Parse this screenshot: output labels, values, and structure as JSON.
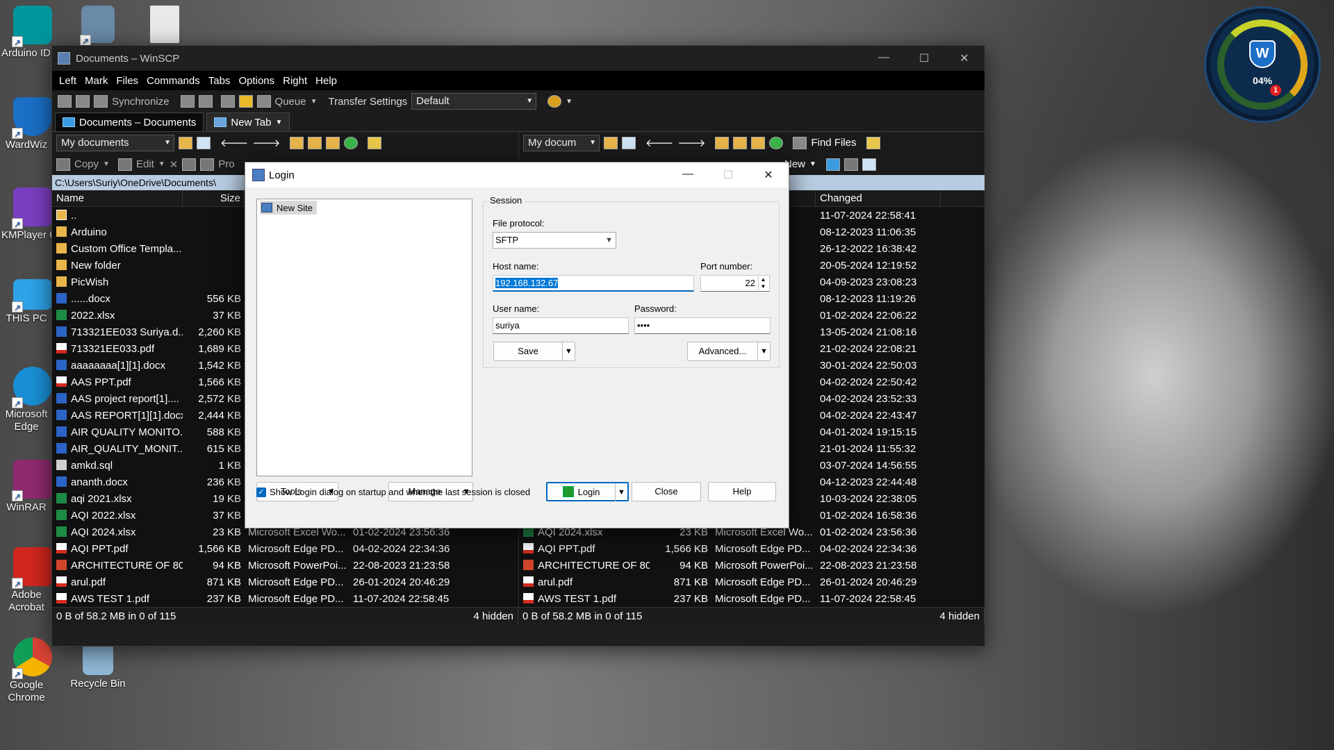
{
  "desktop": {
    "icons": [
      {
        "label": "Arduino IDE"
      },
      {
        "label": "WardWiz"
      },
      {
        "label": "KMPlayer 64"
      },
      {
        "label": "THIS PC"
      },
      {
        "label": "Microsoft Edge"
      },
      {
        "label": "WinRAR"
      },
      {
        "label": "Adobe Acrobat"
      },
      {
        "label": "Google Chrome"
      },
      {
        "label": "Recycle Bin"
      }
    ],
    "gadget": {
      "percent": "04%",
      "badge": "1"
    }
  },
  "window": {
    "title": "Documents – WinSCP",
    "menu": [
      "Left",
      "Mark",
      "Files",
      "Commands",
      "Tabs",
      "Options",
      "Right",
      "Help"
    ],
    "toolbar": {
      "synchronize": "Synchronize",
      "queue": "Queue",
      "transfer_settings": "Transfer Settings",
      "transfer_value": "Default"
    },
    "tabs": [
      {
        "label": "Documents – Documents"
      },
      {
        "label": "New Tab"
      }
    ],
    "left_pane": {
      "location": "My documents",
      "copy": "Copy",
      "edit": "Edit",
      "properties": "Pro",
      "path": "C:\\Users\\Suriy\\OneDrive\\Documents\\",
      "col_name": "Name",
      "col_size": "Size",
      "files": [
        {
          "name": "..",
          "size": "",
          "type": "",
          "changed": "",
          "icon": "up"
        },
        {
          "name": "Arduino",
          "size": "",
          "type": "",
          "changed": "",
          "icon": "folder"
        },
        {
          "name": "Custom Office Templa...",
          "size": "",
          "type": "",
          "changed": "",
          "icon": "folder"
        },
        {
          "name": "New folder",
          "size": "",
          "type": "",
          "changed": "",
          "icon": "folder"
        },
        {
          "name": "PicWish",
          "size": "",
          "type": "",
          "changed": "",
          "icon": "folder"
        },
        {
          "name": "......docx",
          "size": "556 KB",
          "type": "",
          "changed": "",
          "icon": "word"
        },
        {
          "name": "2022.xlsx",
          "size": "37 KB",
          "type": "",
          "changed": "",
          "icon": "excel"
        },
        {
          "name": "713321EE033 Suriya.d...",
          "size": "2,260 KB",
          "type": "",
          "changed": "",
          "icon": "word"
        },
        {
          "name": "713321EE033.pdf",
          "size": "1,689 KB",
          "type": "",
          "changed": "",
          "icon": "pdf"
        },
        {
          "name": "aaaaaaaa[1][1].docx",
          "size": "1,542 KB",
          "type": "",
          "changed": "",
          "icon": "word"
        },
        {
          "name": "AAS PPT.pdf",
          "size": "1,566 KB",
          "type": "",
          "changed": "",
          "icon": "pdf"
        },
        {
          "name": "AAS project report[1]....",
          "size": "2,572 KB",
          "type": "",
          "changed": "",
          "icon": "word"
        },
        {
          "name": "AAS REPORT[1][1].docx",
          "size": "2,444 KB",
          "type": "",
          "changed": "",
          "icon": "word"
        },
        {
          "name": "AIR QUALITY MONITO...",
          "size": "588 KB",
          "type": "",
          "changed": "",
          "icon": "word"
        },
        {
          "name": "AIR_QUALITY_MONIT...",
          "size": "615 KB",
          "type": "",
          "changed": "",
          "icon": "word"
        },
        {
          "name": "amkd.sql",
          "size": "1 KB",
          "type": "",
          "changed": "",
          "icon": "sql"
        },
        {
          "name": "ananth.docx",
          "size": "236 KB",
          "type": "",
          "changed": "",
          "icon": "word"
        },
        {
          "name": "aqi 2021.xlsx",
          "size": "19 KB",
          "type": "",
          "changed": "",
          "icon": "excel"
        },
        {
          "name": "AQI 2022.xlsx",
          "size": "37 KB",
          "type": "",
          "changed": "",
          "icon": "excel"
        },
        {
          "name": "AQI 2024.xlsx",
          "size": "23 KB",
          "type": "Microsoft Excel Wo...",
          "changed": "01-02-2024 23:56:36",
          "icon": "excel"
        },
        {
          "name": "AQI PPT.pdf",
          "size": "1,566 KB",
          "type": "Microsoft Edge PD...",
          "changed": "04-02-2024 22:34:36",
          "icon": "pdf"
        },
        {
          "name": "ARCHITECTURE  OF 80...",
          "size": "94 KB",
          "type": "Microsoft PowerPoi...",
          "changed": "22-08-2023 21:23:58",
          "icon": "ppt"
        },
        {
          "name": "arul.pdf",
          "size": "871 KB",
          "type": "Microsoft Edge PD...",
          "changed": "26-01-2024 20:46:29",
          "icon": "pdf"
        },
        {
          "name": "AWS TEST 1.pdf",
          "size": "237 KB",
          "type": "Microsoft Edge PD...",
          "changed": "11-07-2024 22:58:45",
          "icon": "pdf"
        }
      ],
      "status": "0 B of 58.2 MB in 0 of 115",
      "hidden": "4 hidden"
    },
    "right_pane": {
      "location": "My docum",
      "find_files": "Find Files",
      "new": "New",
      "col_changed": "Changed",
      "files": [
        {
          "name": "",
          "size": "",
          "type": "",
          "changed": "11-07-2024 22:58:41",
          "icon": ""
        },
        {
          "name": "",
          "size": "",
          "type": "",
          "changed": "08-12-2023 11:06:35",
          "icon": ""
        },
        {
          "name": "",
          "size": "",
          "type": "",
          "changed": "26-12-2022 16:38:42",
          "icon": ""
        },
        {
          "name": "",
          "size": "",
          "type": "",
          "changed": "20-05-2024 12:19:52",
          "icon": ""
        },
        {
          "name": "",
          "size": "",
          "type": "",
          "changed": "04-09-2023 23:08:23",
          "icon": ""
        },
        {
          "name": "",
          "size": "",
          "type": "Do...",
          "changed": "08-12-2023 11:19:26",
          "icon": ""
        },
        {
          "name": "",
          "size": "",
          "type": "Wo...",
          "changed": "01-02-2024 22:06:22",
          "icon": ""
        },
        {
          "name": "",
          "size": "",
          "type": "Do...",
          "changed": "13-05-2024 21:08:16",
          "icon": ""
        },
        {
          "name": "",
          "size": "",
          "type": "PD...",
          "changed": "21-02-2024 22:08:21",
          "icon": ""
        },
        {
          "name": "",
          "size": "",
          "type": "Do...",
          "changed": "30-01-2024 22:50:03",
          "icon": ""
        },
        {
          "name": "",
          "size": "",
          "type": "PD...",
          "changed": "04-02-2024 22:50:42",
          "icon": ""
        },
        {
          "name": "",
          "size": "",
          "type": "Do...",
          "changed": "04-02-2024 23:52:33",
          "icon": ""
        },
        {
          "name": "",
          "size": "",
          "type": "Do...",
          "changed": "04-02-2024 22:43:47",
          "icon": ""
        },
        {
          "name": "",
          "size": "",
          "type": "Do...",
          "changed": "04-01-2024 19:15:15",
          "icon": ""
        },
        {
          "name": "",
          "size": "",
          "type": "Do...",
          "changed": "21-01-2024 11:55:32",
          "icon": ""
        },
        {
          "name": "",
          "size": "",
          "type": "",
          "changed": "03-07-2024 14:56:55",
          "icon": ""
        },
        {
          "name": "",
          "size": "",
          "type": "Do...",
          "changed": "04-12-2023 22:44:48",
          "icon": ""
        },
        {
          "name": "",
          "size": "",
          "type": "Wo...",
          "changed": "10-03-2024 22:38:05",
          "icon": ""
        },
        {
          "name": "",
          "size": "",
          "type": "Wo...",
          "changed": "01-02-2024 16:58:36",
          "icon": ""
        },
        {
          "name": "AQI 2024.xlsx",
          "size": "23 KB",
          "type": "Microsoft Excel Wo...",
          "changed": "01-02-2024 23:56:36",
          "icon": "excel"
        },
        {
          "name": "AQI PPT.pdf",
          "size": "1,566 KB",
          "type": "Microsoft Edge PD...",
          "changed": "04-02-2024 22:34:36",
          "icon": "pdf"
        },
        {
          "name": "ARCHITECTURE  OF 80...",
          "size": "94 KB",
          "type": "Microsoft PowerPoi...",
          "changed": "22-08-2023 21:23:58",
          "icon": "ppt"
        },
        {
          "name": "arul.pdf",
          "size": "871 KB",
          "type": "Microsoft Edge PD...",
          "changed": "26-01-2024 20:46:29",
          "icon": "pdf"
        },
        {
          "name": "AWS TEST 1.pdf",
          "size": "237 KB",
          "type": "Microsoft Edge PD...",
          "changed": "11-07-2024 22:58:45",
          "icon": "pdf"
        }
      ],
      "status": "0 B of 58.2 MB in 0 of 115",
      "hidden": "4 hidden"
    }
  },
  "login": {
    "title": "Login",
    "site": "New Site",
    "session_label": "Session",
    "protocol_label": "File protocol:",
    "protocol_value": "SFTP",
    "host_label": "Host name:",
    "host_value": "192.168.132.67",
    "port_label": "Port number:",
    "port_value": "22",
    "user_label": "User name:",
    "user_value": "suriya",
    "password_label": "Password:",
    "password_value": "••••",
    "save": "Save",
    "advanced": "Advanced...",
    "tools": "Tools",
    "manage": "Manage",
    "login_btn": "Login",
    "close_btn": "Close",
    "help_btn": "Help",
    "startup_check": "Show Login dialog on startup and when the last session is closed"
  }
}
